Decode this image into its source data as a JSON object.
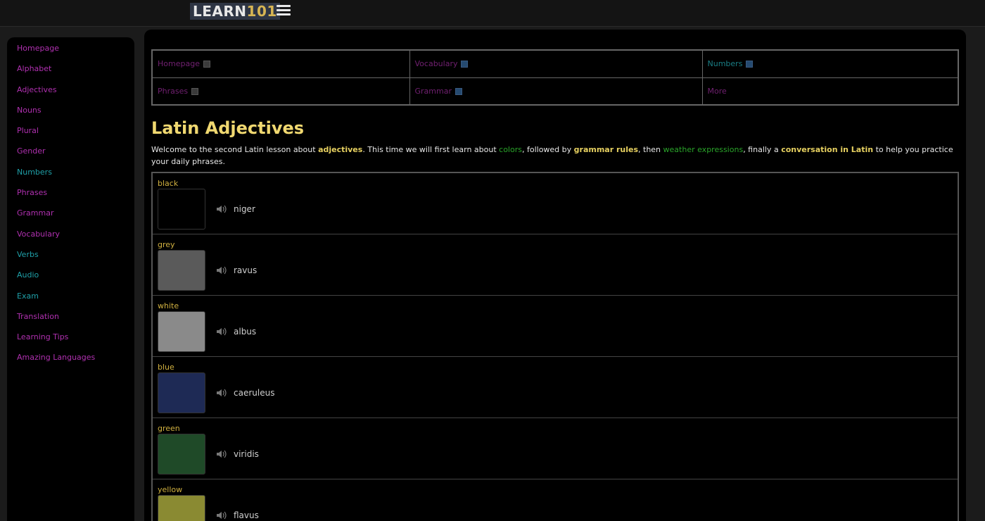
{
  "header": {
    "logo_a": "LEARN",
    "logo_b": "101"
  },
  "sidebar": {
    "items": [
      {
        "label": "Homepage",
        "color": "#b030b0"
      },
      {
        "label": "Alphabet",
        "color": "#b030b0"
      },
      {
        "label": "Adjectives",
        "color": "#b030b0"
      },
      {
        "label": "Nouns",
        "color": "#b030b0"
      },
      {
        "label": "Plural",
        "color": "#b030b0"
      },
      {
        "label": "Gender",
        "color": "#b030b0"
      },
      {
        "label": "Numbers",
        "color": "#1fa0a8"
      },
      {
        "label": "Phrases",
        "color": "#b030b0"
      },
      {
        "label": "Grammar",
        "color": "#b030b0"
      },
      {
        "label": "Vocabulary",
        "color": "#b030b0"
      },
      {
        "label": "Verbs",
        "color": "#1fa0a8"
      },
      {
        "label": "Audio",
        "color": "#1fa0a8"
      },
      {
        "label": "Exam",
        "color": "#1fa0a8"
      },
      {
        "label": "Translation",
        "color": "#b030b0"
      },
      {
        "label": "Learning Tips",
        "color": "#b030b0"
      },
      {
        "label": "Amazing Languages",
        "color": "#b030b0"
      }
    ]
  },
  "nav": {
    "row1": [
      "Homepage",
      "Vocabulary",
      "Numbers"
    ],
    "row2": [
      "Phrases",
      "Grammar",
      "More"
    ]
  },
  "main": {
    "title": "Latin Adjectives",
    "intro": {
      "t1": "Welcome to the second Latin lesson about ",
      "k1": "adjectives",
      "t2": ". This time we will first learn about ",
      "k2": "colors",
      "t3": ", followed by ",
      "k3": "grammar rules",
      "t4": ", then ",
      "k4": "weather expressions",
      "t5": ", finally a ",
      "k5": "conversation in Latin",
      "t6": " to help you practice your daily phrases."
    }
  },
  "colors": [
    {
      "name": "black",
      "latin": "niger",
      "swatch": "#000000"
    },
    {
      "name": "grey",
      "latin": "ravus",
      "swatch": "#5a5a5a"
    },
    {
      "name": "white",
      "latin": "albus",
      "swatch": "#8a8a8a"
    },
    {
      "name": "blue",
      "latin": "caeruleus",
      "swatch": "#1e2a55"
    },
    {
      "name": "green",
      "latin": "viridis",
      "swatch": "#1f4a28"
    },
    {
      "name": "yellow",
      "latin": "flavus",
      "swatch": "#8a8a32"
    }
  ]
}
